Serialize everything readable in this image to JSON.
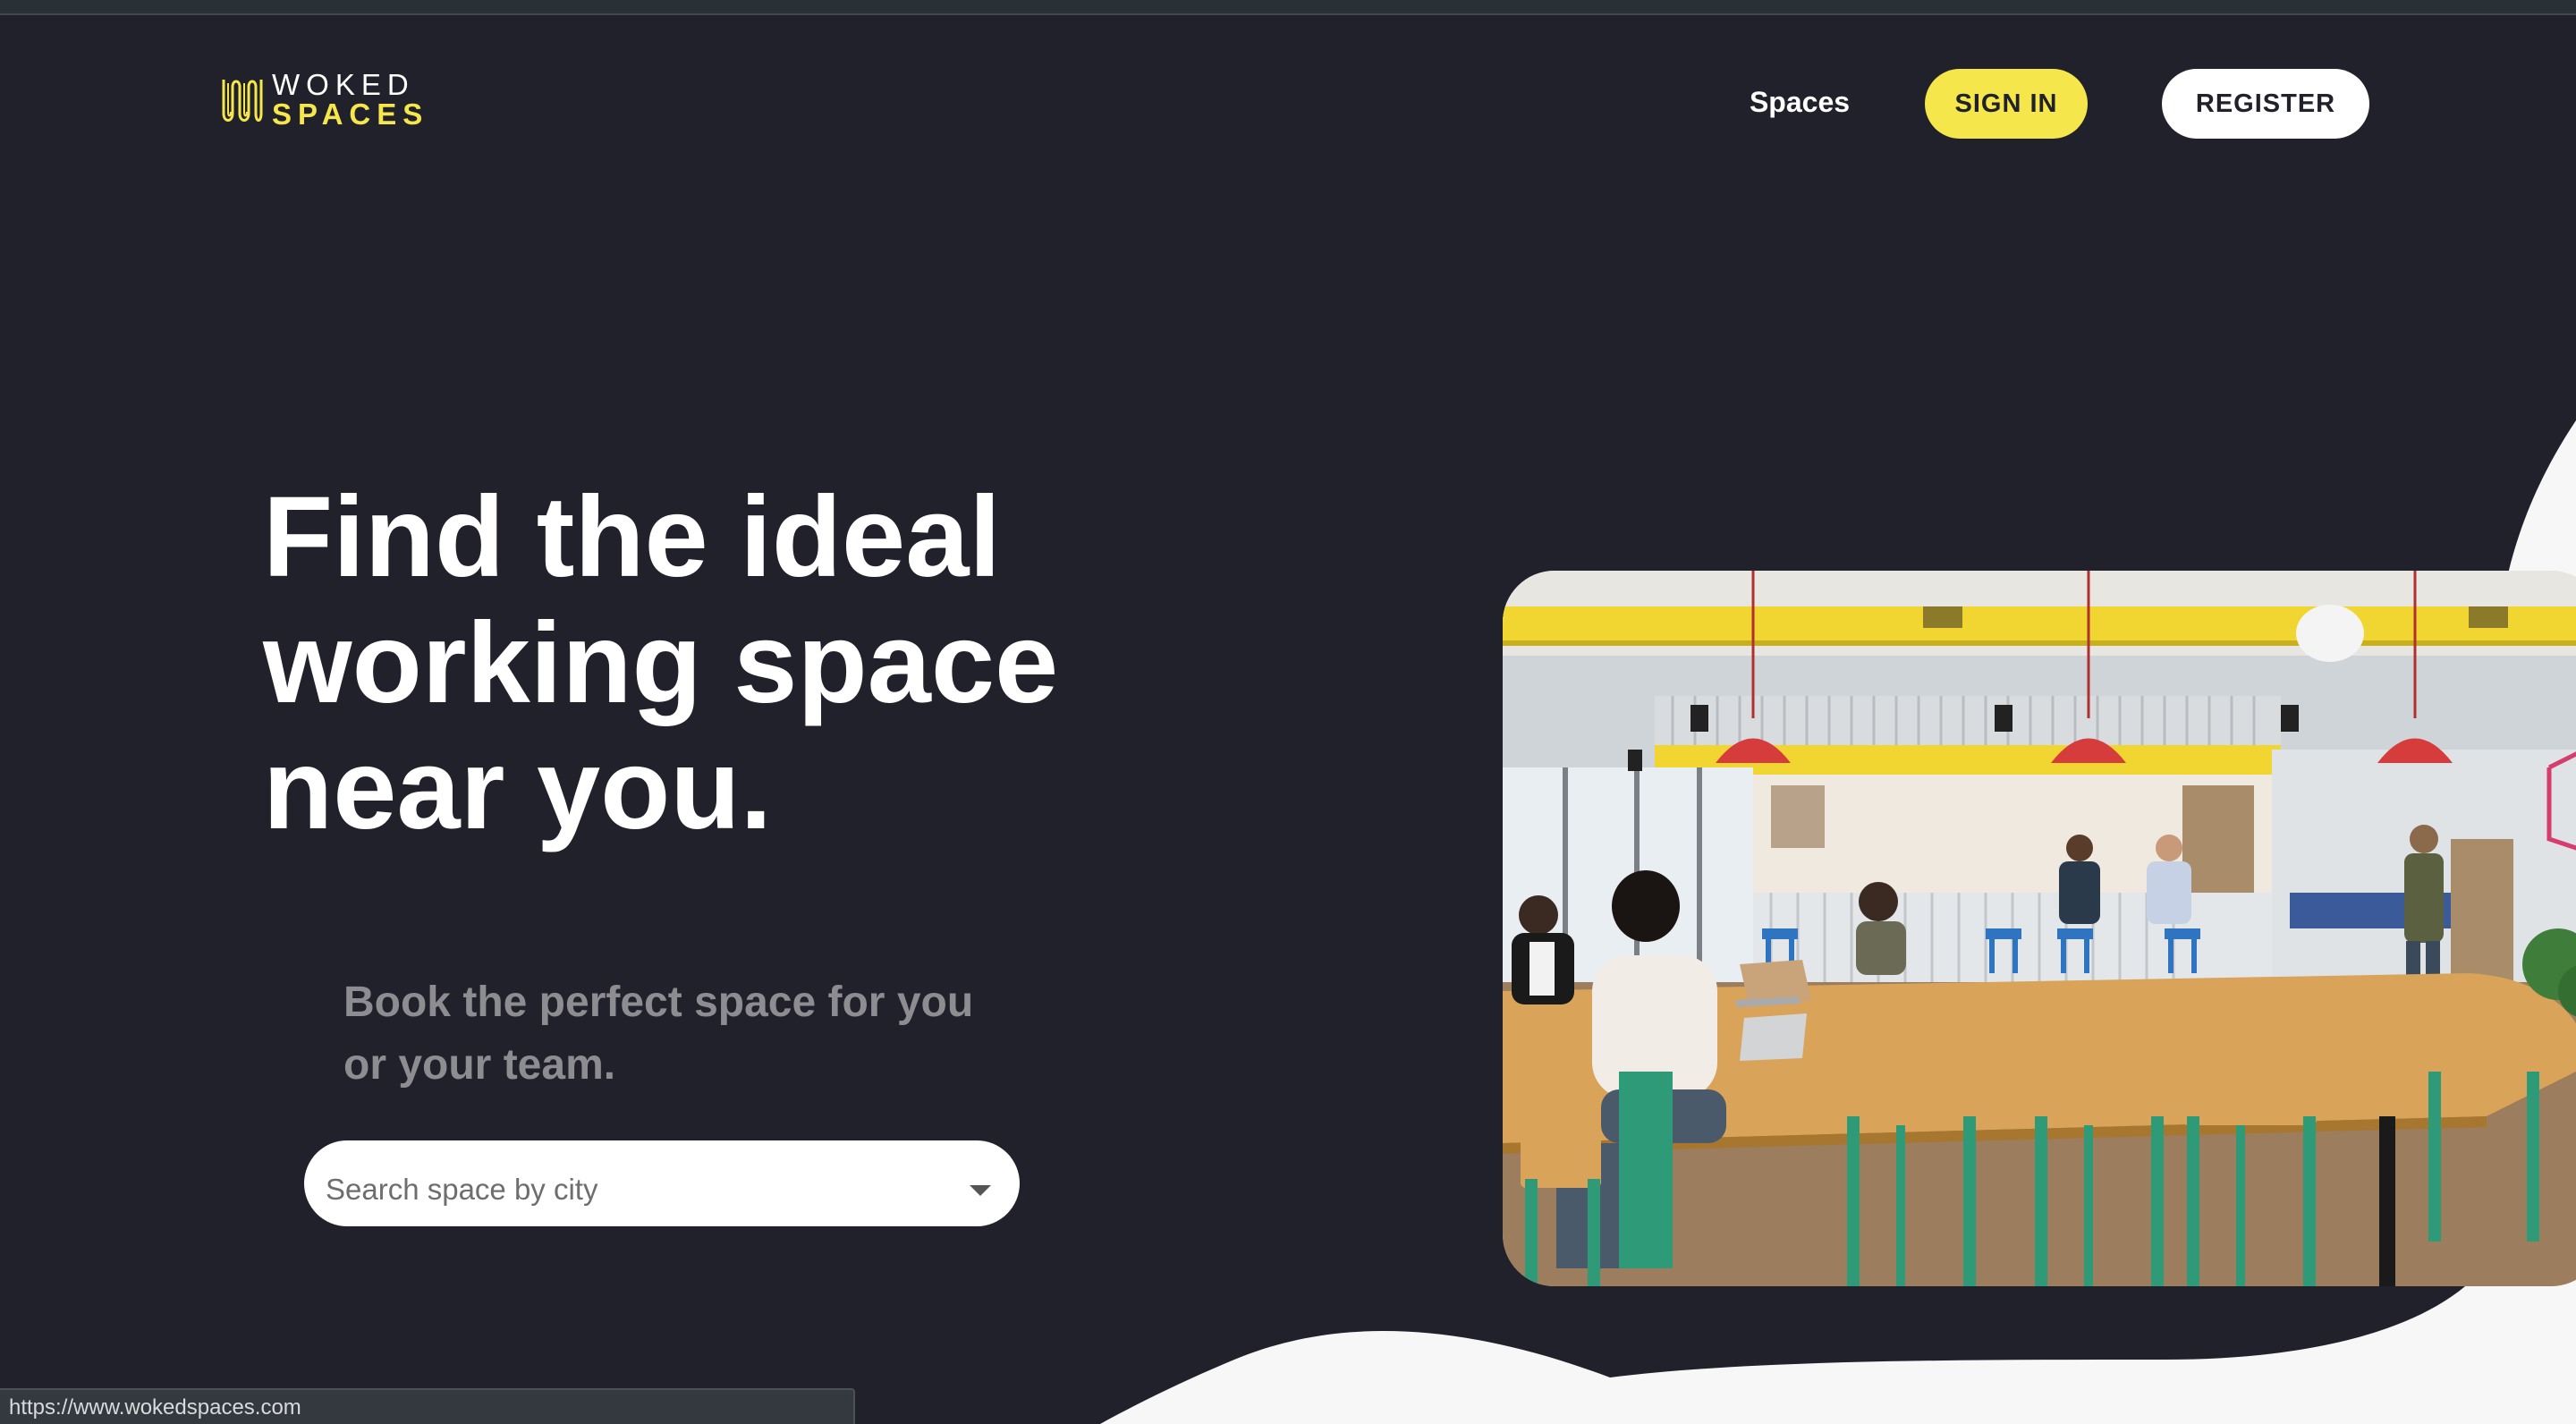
{
  "brand": {
    "name_line1": "WOKED",
    "name_line2": "SPACES",
    "accent_color": "#f5e64c",
    "background_color": "#21212b"
  },
  "nav": {
    "spaces_label": "Spaces",
    "sign_in_label": "SIGN IN",
    "register_label": "REGISTER"
  },
  "hero": {
    "title_lines": [
      "Find the ideal",
      "working space",
      "near you."
    ],
    "subtitle_lines": [
      "Book the perfect space for you",
      "or your team."
    ],
    "image_alt": "open-plan-office-photo"
  },
  "search": {
    "placeholder": "Search space by city",
    "value": ""
  },
  "status_bar": {
    "url": "https://www.wokedspaces.com"
  }
}
